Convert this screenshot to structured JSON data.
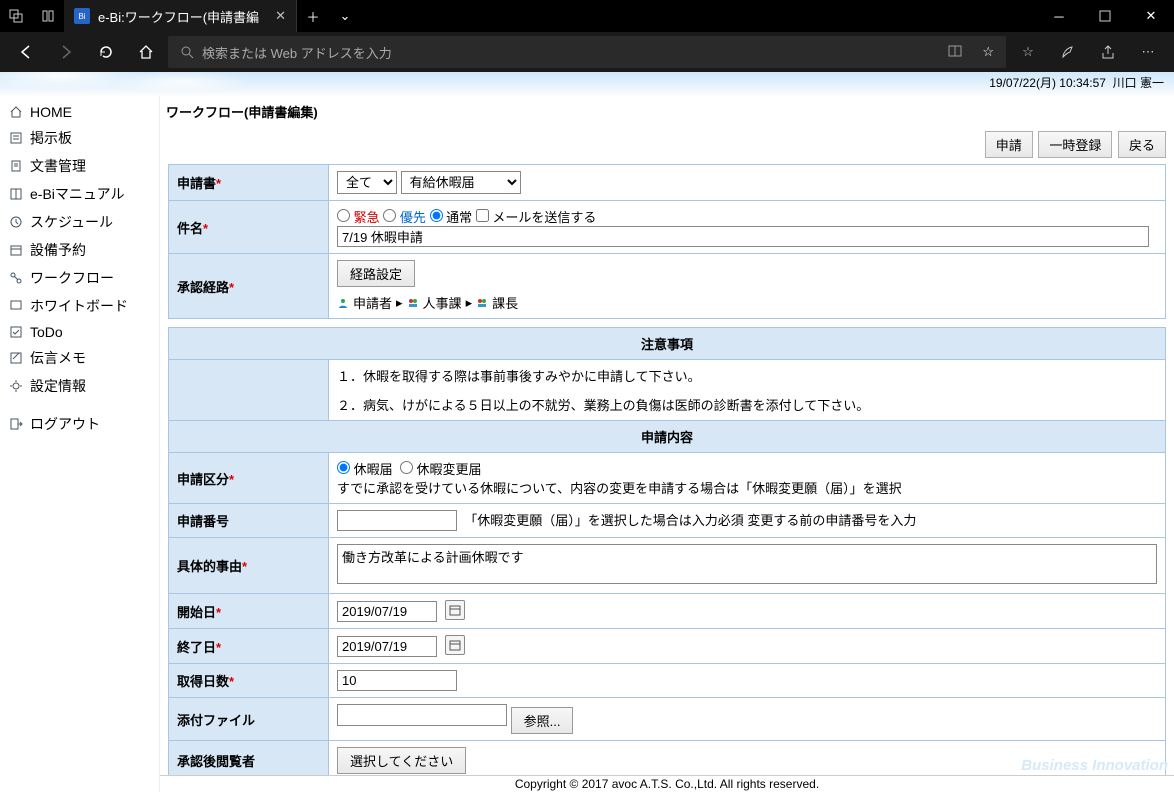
{
  "browser": {
    "tab_title": "e-Bi:ワークフロー(申請書編",
    "search_placeholder": "検索または Web アドレスを入力"
  },
  "status": {
    "datetime": "19/07/22(月) 10:34:57",
    "user": "川口 憲一"
  },
  "sidebar": {
    "items": [
      {
        "label": "HOME"
      },
      {
        "label": "掲示板"
      },
      {
        "label": "文書管理"
      },
      {
        "label": "e-Biマニュアル"
      },
      {
        "label": "スケジュール"
      },
      {
        "label": "設備予約"
      },
      {
        "label": "ワークフロー"
      },
      {
        "label": "ホワイトボード"
      },
      {
        "label": "ToDo"
      },
      {
        "label": "伝言メモ"
      },
      {
        "label": "設定情報"
      },
      {
        "label": "ログアウト"
      }
    ]
  },
  "page": {
    "title": "ワークフロー(申請書編集)",
    "buttons": {
      "apply": "申請",
      "save_temp": "一時登録",
      "back": "戻る"
    }
  },
  "form": {
    "labels": {
      "document": "申請書",
      "subject": "件名",
      "route": "承認経路",
      "notice_head": "注意事項",
      "content_head": "申請内容",
      "category": "申請区分",
      "app_no": "申請番号",
      "reason": "具体的事由",
      "start": "開始日",
      "end": "終了日",
      "days": "取得日数",
      "attach": "添付ファイル",
      "viewers": "承認後閲覧者"
    },
    "document": {
      "select_all": "全て",
      "select_type": "有給休暇届"
    },
    "priority": {
      "urgent": "緊急",
      "high": "優先",
      "normal": "通常",
      "mail": "メールを送信する"
    },
    "subject_value": "7/19 休暇申請",
    "route": {
      "button": "経路設定",
      "applicant": "申請者",
      "hr": "人事課",
      "chief": "課長"
    },
    "notice": {
      "line1": "１．休暇を取得する際は事前事後すみやかに申請して下さい。",
      "line2": "２．病気、けがによる５日以上の不就労、業務上の負傷は医師の診断書を添付して下さい。"
    },
    "category": {
      "leave": "休暇届",
      "change": "休暇変更届",
      "help": "すでに承認を受けている休暇について、内容の変更を申請する場合は「休暇変更願（届）」を選択"
    },
    "app_no": {
      "value": "",
      "help": "「休暇変更願（届）」を選択した場合は入力必須 変更する前の申請番号を入力"
    },
    "reason_value": "働き方改革による計画休暇です",
    "start_value": "2019/07/19",
    "end_value": "2019/07/19",
    "days_value": "10",
    "attach": {
      "browse": "参照..."
    },
    "viewers_btn": "選択してください"
  },
  "footer": {
    "watermark": "Business Innovation",
    "copyright": "Copyright © 2017 avoc A.T.S. Co.,Ltd. All rights reserved."
  }
}
